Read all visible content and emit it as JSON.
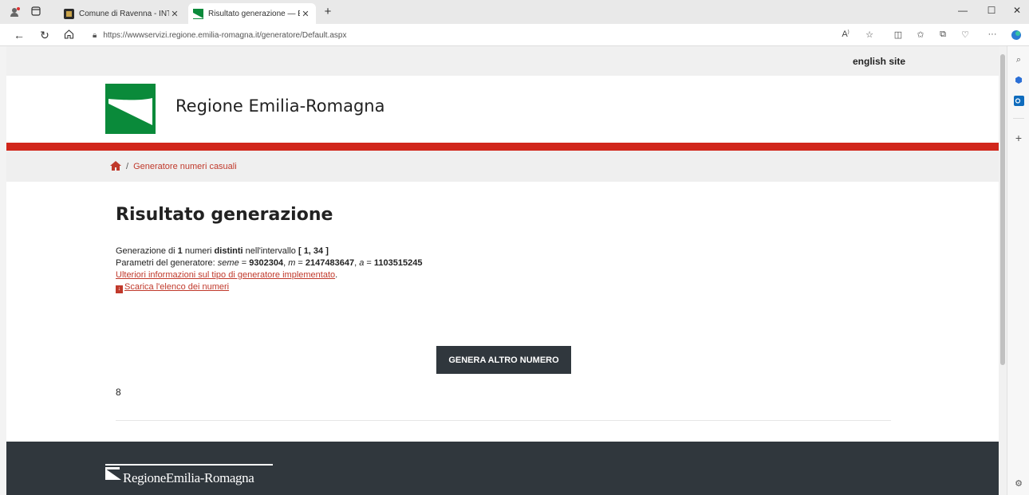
{
  "browser": {
    "tabs": [
      {
        "title": "Comune di Ravenna - INTRANET",
        "active": false
      },
      {
        "title": "Risultato generazione — E-R Il portale",
        "active": true
      }
    ],
    "new_tab": "+",
    "url": "https://wwwservizi.regione.emilia-romagna.it/generatore/Default.aspx"
  },
  "header": {
    "english_link": "english site",
    "brand_name": "Regione Emilia-Romagna"
  },
  "breadcrumb": {
    "separator": "/",
    "current": "Generatore numeri casuali"
  },
  "main": {
    "title": "Risultato generazione",
    "line1": {
      "prefix": "Generazione di ",
      "count": "1",
      "mid1": " numeri ",
      "distinct": "distinti",
      "mid2": " nell'intervallo ",
      "range": "[ 1, 34 ]"
    },
    "line2": {
      "prefix": "Parametri del generatore: ",
      "seme_label": "seme",
      "seme_value": "9302304",
      "m_label": "m",
      "m_value": "2147483647",
      "a_label": "a",
      "a_value": "1103515245"
    },
    "info_link": "Ulteriori informazioni sul tipo di generatore implementato",
    "download_link": "Scarica l'elenco dei numeri",
    "button_label": "GENERA ALTRO NUMERO",
    "result": "8"
  },
  "footer": {
    "logo_text": "RegioneEmilia-Romagna"
  },
  "colors": {
    "accent_red": "#d1261b",
    "link_red": "#c0392b",
    "dark": "#30373d",
    "brand_green": "#0a8a3a"
  }
}
